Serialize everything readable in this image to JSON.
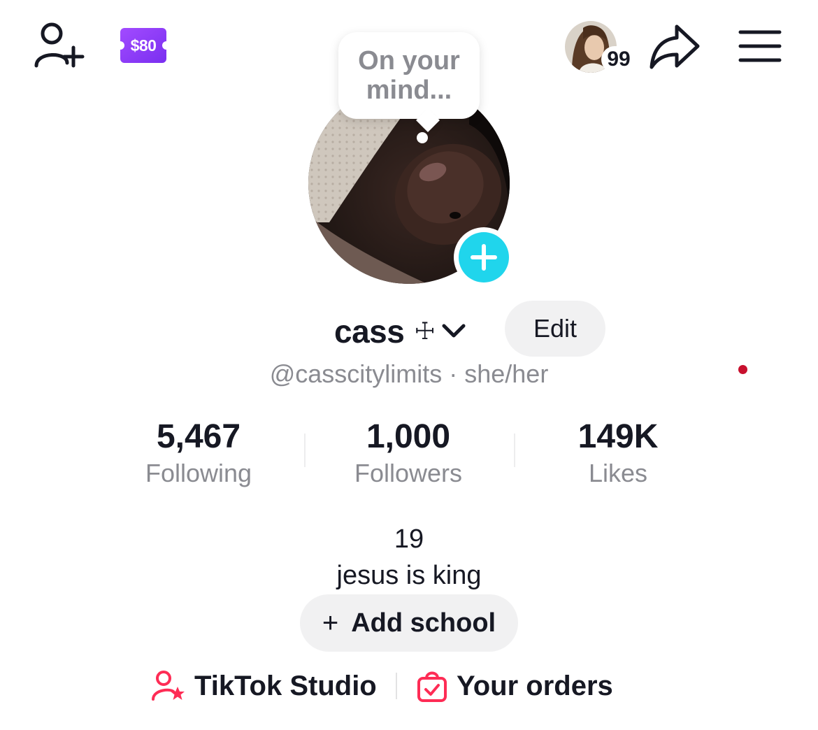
{
  "topbar": {
    "coupon_label": "$80",
    "story_count": "99"
  },
  "profile": {
    "bubble_text": "On your mind...",
    "display_name": "cass",
    "name_glyph": "☩",
    "edit_label": "Edit",
    "handle_line": "@casscitylimits · she/her"
  },
  "stats": [
    {
      "value": "5,467",
      "label": "Following"
    },
    {
      "value": "1,000",
      "label": "Followers"
    },
    {
      "value": "149K",
      "label": "Likes"
    }
  ],
  "bio": {
    "line1": "19",
    "line2": "jesus is king"
  },
  "add_school": {
    "plus": "+",
    "label": "Add school"
  },
  "links": {
    "studio_label": "TikTok Studio",
    "orders_label": "Your orders"
  },
  "colors": {
    "accent_cyan": "#20d5ec",
    "coupon_purple": "#8b3dff",
    "link_icon_red": "#fe2c55",
    "muted_text": "#8a8b91"
  },
  "icons": {
    "add_friend": "add-friend-icon",
    "coupon": "coupon-icon",
    "share": "share-icon",
    "menu": "menu-icon",
    "studio": "studio-icon",
    "orders": "orders-icon"
  }
}
